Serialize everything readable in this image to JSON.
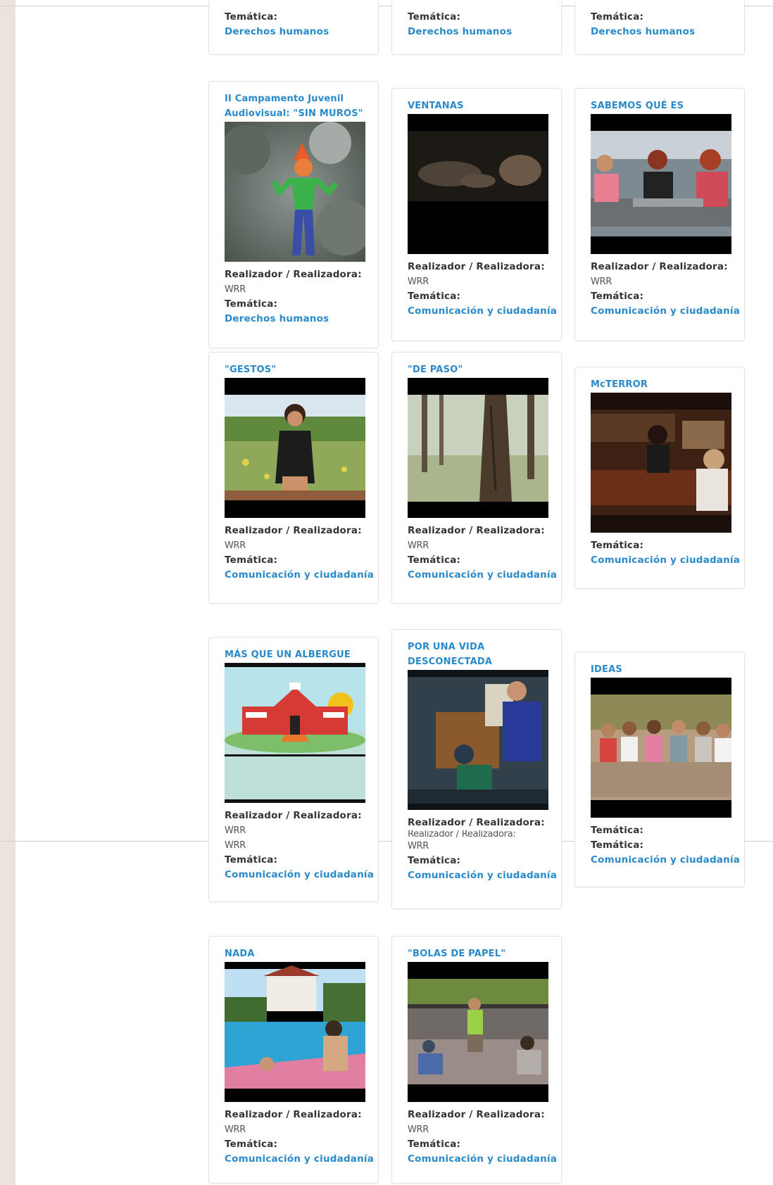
{
  "labels": {
    "director": "Realizador / Realizadora:",
    "theme": "Temática:",
    "director_value": "WRR",
    "theme_ddhh": "Derechos humanos",
    "theme_comm": "Comunicación y ciudadanía",
    "overlap_text": "Realizador / Realizadora:"
  },
  "cards": {
    "top1": {
      "theme_label": "Temática:",
      "theme": "Derechos humanos"
    },
    "top2": {
      "theme_label": "Temática:",
      "theme": "Derechos humanos"
    },
    "top3": {
      "theme_label": "Temática:",
      "theme": "Derechos humanos"
    },
    "campamento": {
      "title": "II Campamento Juvenil Audiovisual: \"SIN MUROS\"",
      "thumbnail": "cartoon-figure-on-trees"
    },
    "ventanas": {
      "title": "VENTANAS",
      "thumbnail": "dark-bedroom-scene"
    },
    "sabemos": {
      "title": "SABEMOS QUÉ ES",
      "thumbnail": "three-women-cafe-table"
    },
    "gestos": {
      "title": "\"GESTOS\"",
      "thumbnail": "woman-on-bench-meadow"
    },
    "depaso": {
      "title": "\"DE PASO\"",
      "thumbnail": "pine-trunk-forest"
    },
    "mcterror": {
      "title": "McTERROR",
      "thumbnail": "bar-counter-interior"
    },
    "albergue": {
      "title": "MÁS QUE UN ALBERGUE",
      "thumbnail": "drawn-red-house"
    },
    "desconectada": {
      "title": "POR UNA VIDA DESCONECTADA",
      "thumbnail": "kids-at-computer"
    },
    "ideas": {
      "title": "IDEAS",
      "thumbnail": "group-of-kids-sitting"
    },
    "nada": {
      "title": "NADA",
      "thumbnail": "pool-scene"
    },
    "bolas": {
      "title": "\"BOLAS DE PAPEL\"",
      "thumbnail": "kids-on-patio"
    }
  },
  "colors": {
    "accent": "#2a8ac9",
    "label": "#333333",
    "strip": "#ece3de"
  }
}
